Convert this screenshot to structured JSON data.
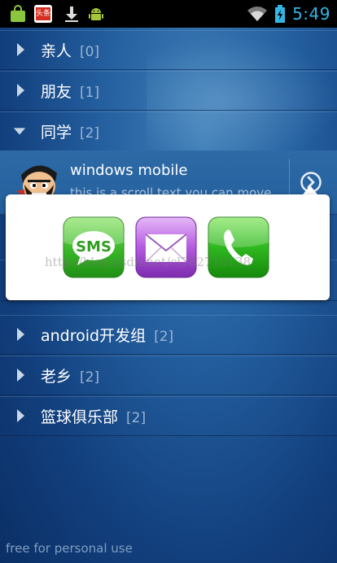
{
  "status_bar": {
    "time": "5:49",
    "icons": [
      "shopping-bag-icon",
      "news-app-icon",
      "download-icon",
      "android-icon",
      "wifi-icon",
      "battery-charging-icon"
    ],
    "news_icon_label": "头条"
  },
  "groups": [
    {
      "name": "亲人",
      "count": "[0]",
      "expanded": false
    },
    {
      "name": "朋友",
      "count": "[1]",
      "expanded": false
    },
    {
      "name": "同学",
      "count": "[2]",
      "expanded": true
    },
    {
      "name": "android开发组",
      "count": "[2]",
      "expanded": false
    },
    {
      "name": "老乡",
      "count": "[2]",
      "expanded": false
    },
    {
      "name": "篮球俱乐部",
      "count": "[2]",
      "expanded": false
    }
  ],
  "contact": {
    "title": "windows mobile",
    "subtitle": "this is a scroll text,you can move"
  },
  "popup": {
    "sms_label": "SMS",
    "watermark": "http://blog.csdn.net/cl782716138"
  },
  "footer": "free for personal use",
  "colors": {
    "accent_time": "#33b5e5",
    "sms_green": "#3cbb2a",
    "mail_purple": "#b45be0",
    "call_green": "#2fb81f"
  }
}
